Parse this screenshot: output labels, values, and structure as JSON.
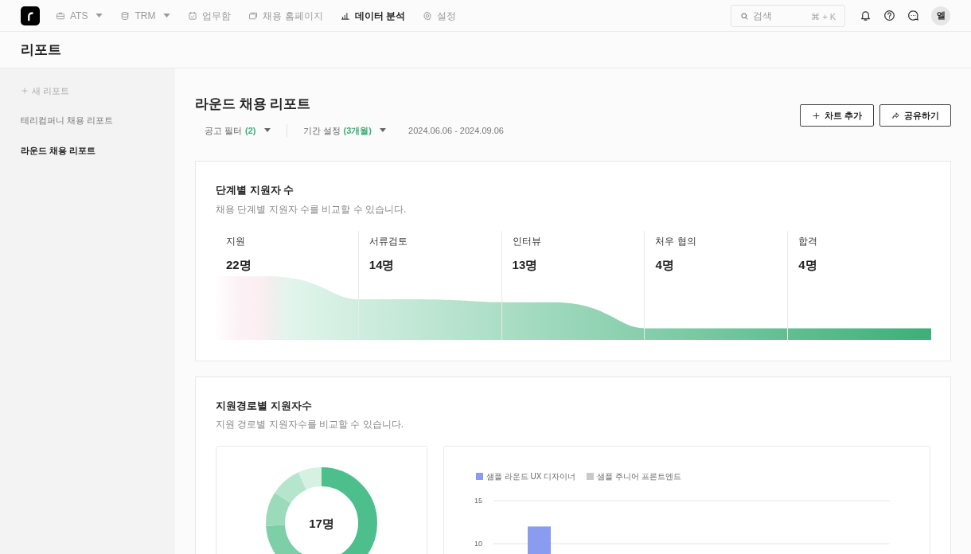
{
  "nav": {
    "items": [
      {
        "label": "ATS",
        "dropdown": true,
        "selected": false
      },
      {
        "label": "TRM",
        "dropdown": true,
        "selected": false
      },
      {
        "label": "업무함",
        "dropdown": false,
        "selected": false
      },
      {
        "label": "채용 홈페이지",
        "dropdown": false,
        "selected": false
      },
      {
        "label": "데이터 분석",
        "dropdown": false,
        "selected": true
      },
      {
        "label": "설정",
        "dropdown": false,
        "selected": false
      }
    ],
    "search": {
      "placeholder": "검색",
      "shortcut": "⌘ + K"
    },
    "avatar": "엘"
  },
  "page_title": "리포트",
  "sidebar": {
    "new_report": "새 리포트",
    "items": [
      {
        "label": "테리컴퍼니 채용 리포트",
        "selected": false
      },
      {
        "label": "라운드 채용 리포트",
        "selected": true
      }
    ]
  },
  "report": {
    "title": "라운드 채용 리포트",
    "filters": [
      {
        "label": "공고 필터",
        "value": "(2)"
      },
      {
        "label": "기간 설정",
        "value": "(3개월)"
      }
    ],
    "date_range": "2024.06.06 - 2024.09.06",
    "buttons": [
      "차트 추가",
      "공유하기"
    ]
  },
  "funnel_card": {
    "title": "단계별 지원자 수",
    "subtitle": "채용 단계별 지원자 수를 비교할 수 있습니다.",
    "stages": [
      {
        "label": "지원",
        "count": "22명"
      },
      {
        "label": "서류검토",
        "count": "14명"
      },
      {
        "label": "인터뷰",
        "count": "13명"
      },
      {
        "label": "처우 협의",
        "count": "4명"
      },
      {
        "label": "합격",
        "count": "4명"
      }
    ]
  },
  "source_card": {
    "title": "지원경로별 지원자수",
    "subtitle": "지원 경로별 지원자수를 비교할 수 있습니다.",
    "donut_total": "17명",
    "chart_data": {
      "type": "bar",
      "ylim": [
        0,
        15
      ],
      "yticks": [
        10,
        15
      ],
      "series": [
        {
          "name": "샘플 라운드 UX 디자이너",
          "color": "#8a9cef",
          "values": [
            12
          ]
        },
        {
          "name": "샘플 주니어 프론트엔드",
          "color": "#c9c9c9",
          "values": [
            null
          ]
        }
      ]
    }
  }
}
